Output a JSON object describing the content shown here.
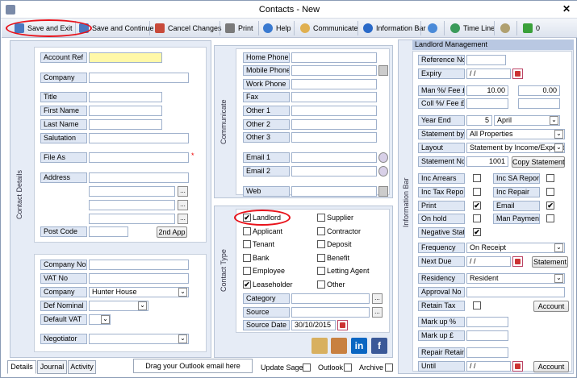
{
  "window": {
    "title": "Contacts  - New"
  },
  "toolbar": {
    "save_exit": "Save and Exit",
    "save_continue": "Save and Continue",
    "cancel": "Cancel Changes",
    "print": "Print",
    "help": "Help",
    "communicate": "Communicate",
    "info_bar": "Information Bar",
    "time_line": "Time Line",
    "count": "0"
  },
  "contact_details": {
    "section_label": "Contact Details",
    "account_ref": "Account Ref",
    "company": "Company",
    "title": "Title",
    "first_name": "First Name",
    "last_name": "Last Name",
    "salutation": "Salutation",
    "file_as": "File As",
    "file_as_required": "*",
    "address": "Address",
    "post_code": "Post Code",
    "second_app": "2nd App"
  },
  "company_info": {
    "company_no": "Company No",
    "vat_no": "VAT No",
    "company": "Company",
    "company_value": "Hunter House",
    "def_nominal": "Def Nominal",
    "default_vat": "Default VAT",
    "negotiator": "Negotiator"
  },
  "communicate": {
    "section_label": "Communicate",
    "home_phone": "Home Phone",
    "mobile_phone": "Mobile Phone",
    "work_phone": "Work Phone",
    "fax": "Fax",
    "other1": "Other 1",
    "other2": "Other 2",
    "other3": "Other 3",
    "email1": "Email 1",
    "email2": "Email 2",
    "web": "Web"
  },
  "contact_type": {
    "section_label": "Contact Type",
    "landlord": "Landlord",
    "supplier": "Supplier",
    "applicant": "Applicant",
    "contractor": "Contractor",
    "tenant": "Tenant",
    "deposit": "Deposit",
    "bank": "Bank",
    "benefit": "Benefit",
    "employee": "Employee",
    "letting_agent": "Letting Agent",
    "leaseholder": "Leaseholder",
    "other": "Other",
    "category": "Category",
    "source": "Source",
    "source_date": "Source Date",
    "source_date_value": "30/10/2015",
    "check": "✔"
  },
  "landlord": {
    "header": "Landlord Management",
    "section_label": "Information Bar",
    "reference_no": "Reference No",
    "expiry": "Expiry",
    "expiry_value": "/ /",
    "man_fee": "Man %/ Fee £",
    "man_fee_value": "10.00",
    "man_fee_value2": "0.00",
    "coll_fee": "Coll %/ Fee £",
    "year_end": "Year End",
    "year_end_day": "5",
    "year_end_month": "April",
    "statement_by": "Statement by",
    "statement_by_value": "All Properties",
    "layout": "Layout",
    "layout_value": "Statement by Income/Expend",
    "statement_no": "Statement No",
    "statement_no_value": "1001",
    "copy_statement": "Copy Statement",
    "inc_arrears": "Inc Arrears",
    "inc_sa_report": "Inc SA Report",
    "inc_tax_report": "Inc Tax Report",
    "inc_repair": "Inc Repair",
    "print": "Print",
    "email": "Email",
    "on_hold": "On hold",
    "man_payment": "Man Payment",
    "negative_stat": "Negative Stat",
    "frequency": "Frequency",
    "frequency_value": "On Receipt",
    "next_due": "Next Due",
    "next_due_value": "/ /",
    "statement_btn": "Statement",
    "residency": "Residency",
    "residency_value": "Resident",
    "approval_no": "Approval No",
    "retain_tax": "Retain Tax",
    "account_btn": "Account",
    "mark_up_pct": "Mark up %",
    "mark_up_gbp": "Mark up £",
    "repair_retain": "Repair Retain",
    "until": "Until",
    "until_value": "/ /",
    "account_btn2": "Account"
  },
  "footer": {
    "tab_details": "Details",
    "tab_journal": "Journal",
    "tab_activity": "Activity",
    "drag_hint": "Drag your Outlook email here",
    "update_sage": "Update Sage",
    "outlook": "Outlook",
    "archive": "Archive"
  },
  "colors": {
    "accent": "#e8121a",
    "account_ref_bg": "#fff8a8"
  }
}
